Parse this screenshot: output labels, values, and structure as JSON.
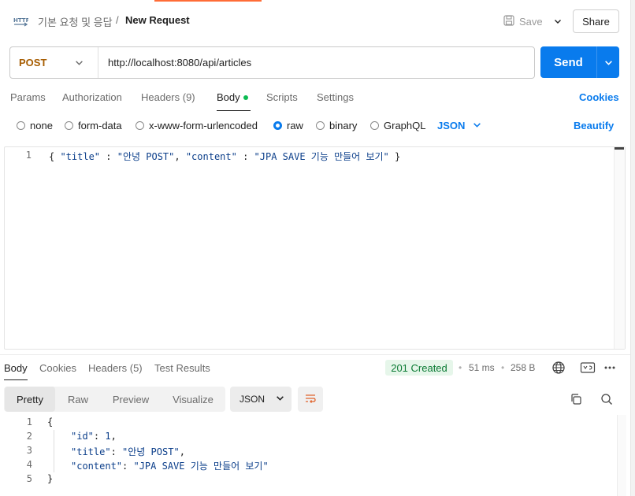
{
  "header": {
    "breadcrumb_parent": "기본 요청 및 응답",
    "breadcrumb_sep": "/",
    "title": "New Request",
    "save_label": "Save",
    "share_label": "Share"
  },
  "request": {
    "method": "POST",
    "url": "http://localhost:8080/api/articles",
    "send_label": "Send"
  },
  "request_tabs": {
    "params": "Params",
    "authorization": "Authorization",
    "headers": "Headers (9)",
    "body": "Body",
    "scripts": "Scripts",
    "settings": "Settings",
    "cookies": "Cookies"
  },
  "body_types": {
    "none": "none",
    "form_data": "form-data",
    "urlencoded": "x-www-form-urlencoded",
    "raw": "raw",
    "binary": "binary",
    "graphql": "GraphQL",
    "format": "JSON",
    "beautify": "Beautify",
    "selected": "raw"
  },
  "editor": {
    "lines": [
      {
        "n": "1",
        "open": "{ ",
        "k1": "\"title\"",
        "sep1": " : ",
        "v1": "\"안녕 POST\"",
        "comma": ", ",
        "k2": "\"content\"",
        "sep2": " : ",
        "v2": "\"JPA SAVE 기능 만들어 보기\"",
        "close": " }"
      }
    ]
  },
  "response_tabs": {
    "body": "Body",
    "cookies": "Cookies",
    "headers": "Headers (5)",
    "test_results": "Test Results"
  },
  "response_meta": {
    "status": "201 Created",
    "time": "51 ms",
    "size": "258 B",
    "sep": "•",
    "status_color": "#0a7a33"
  },
  "response_view": {
    "pretty": "Pretty",
    "raw": "Raw",
    "preview": "Preview",
    "visualize": "Visualize",
    "format": "JSON"
  },
  "response_body": {
    "line_numbers": [
      "1",
      "2",
      "3",
      "4",
      "5"
    ],
    "open": "{",
    "close": "}",
    "id_key": "\"id\"",
    "id_val": "1",
    "title_key": "\"title\"",
    "title_val": "\"안녕 POST\"",
    "content_key": "\"content\"",
    "content_val": "\"JPA SAVE 기능 만들어 보기\""
  },
  "colors": {
    "accent": "#ff6c37",
    "primary": "#097bed",
    "method": "#a65c00",
    "success": "#0cbb52"
  }
}
